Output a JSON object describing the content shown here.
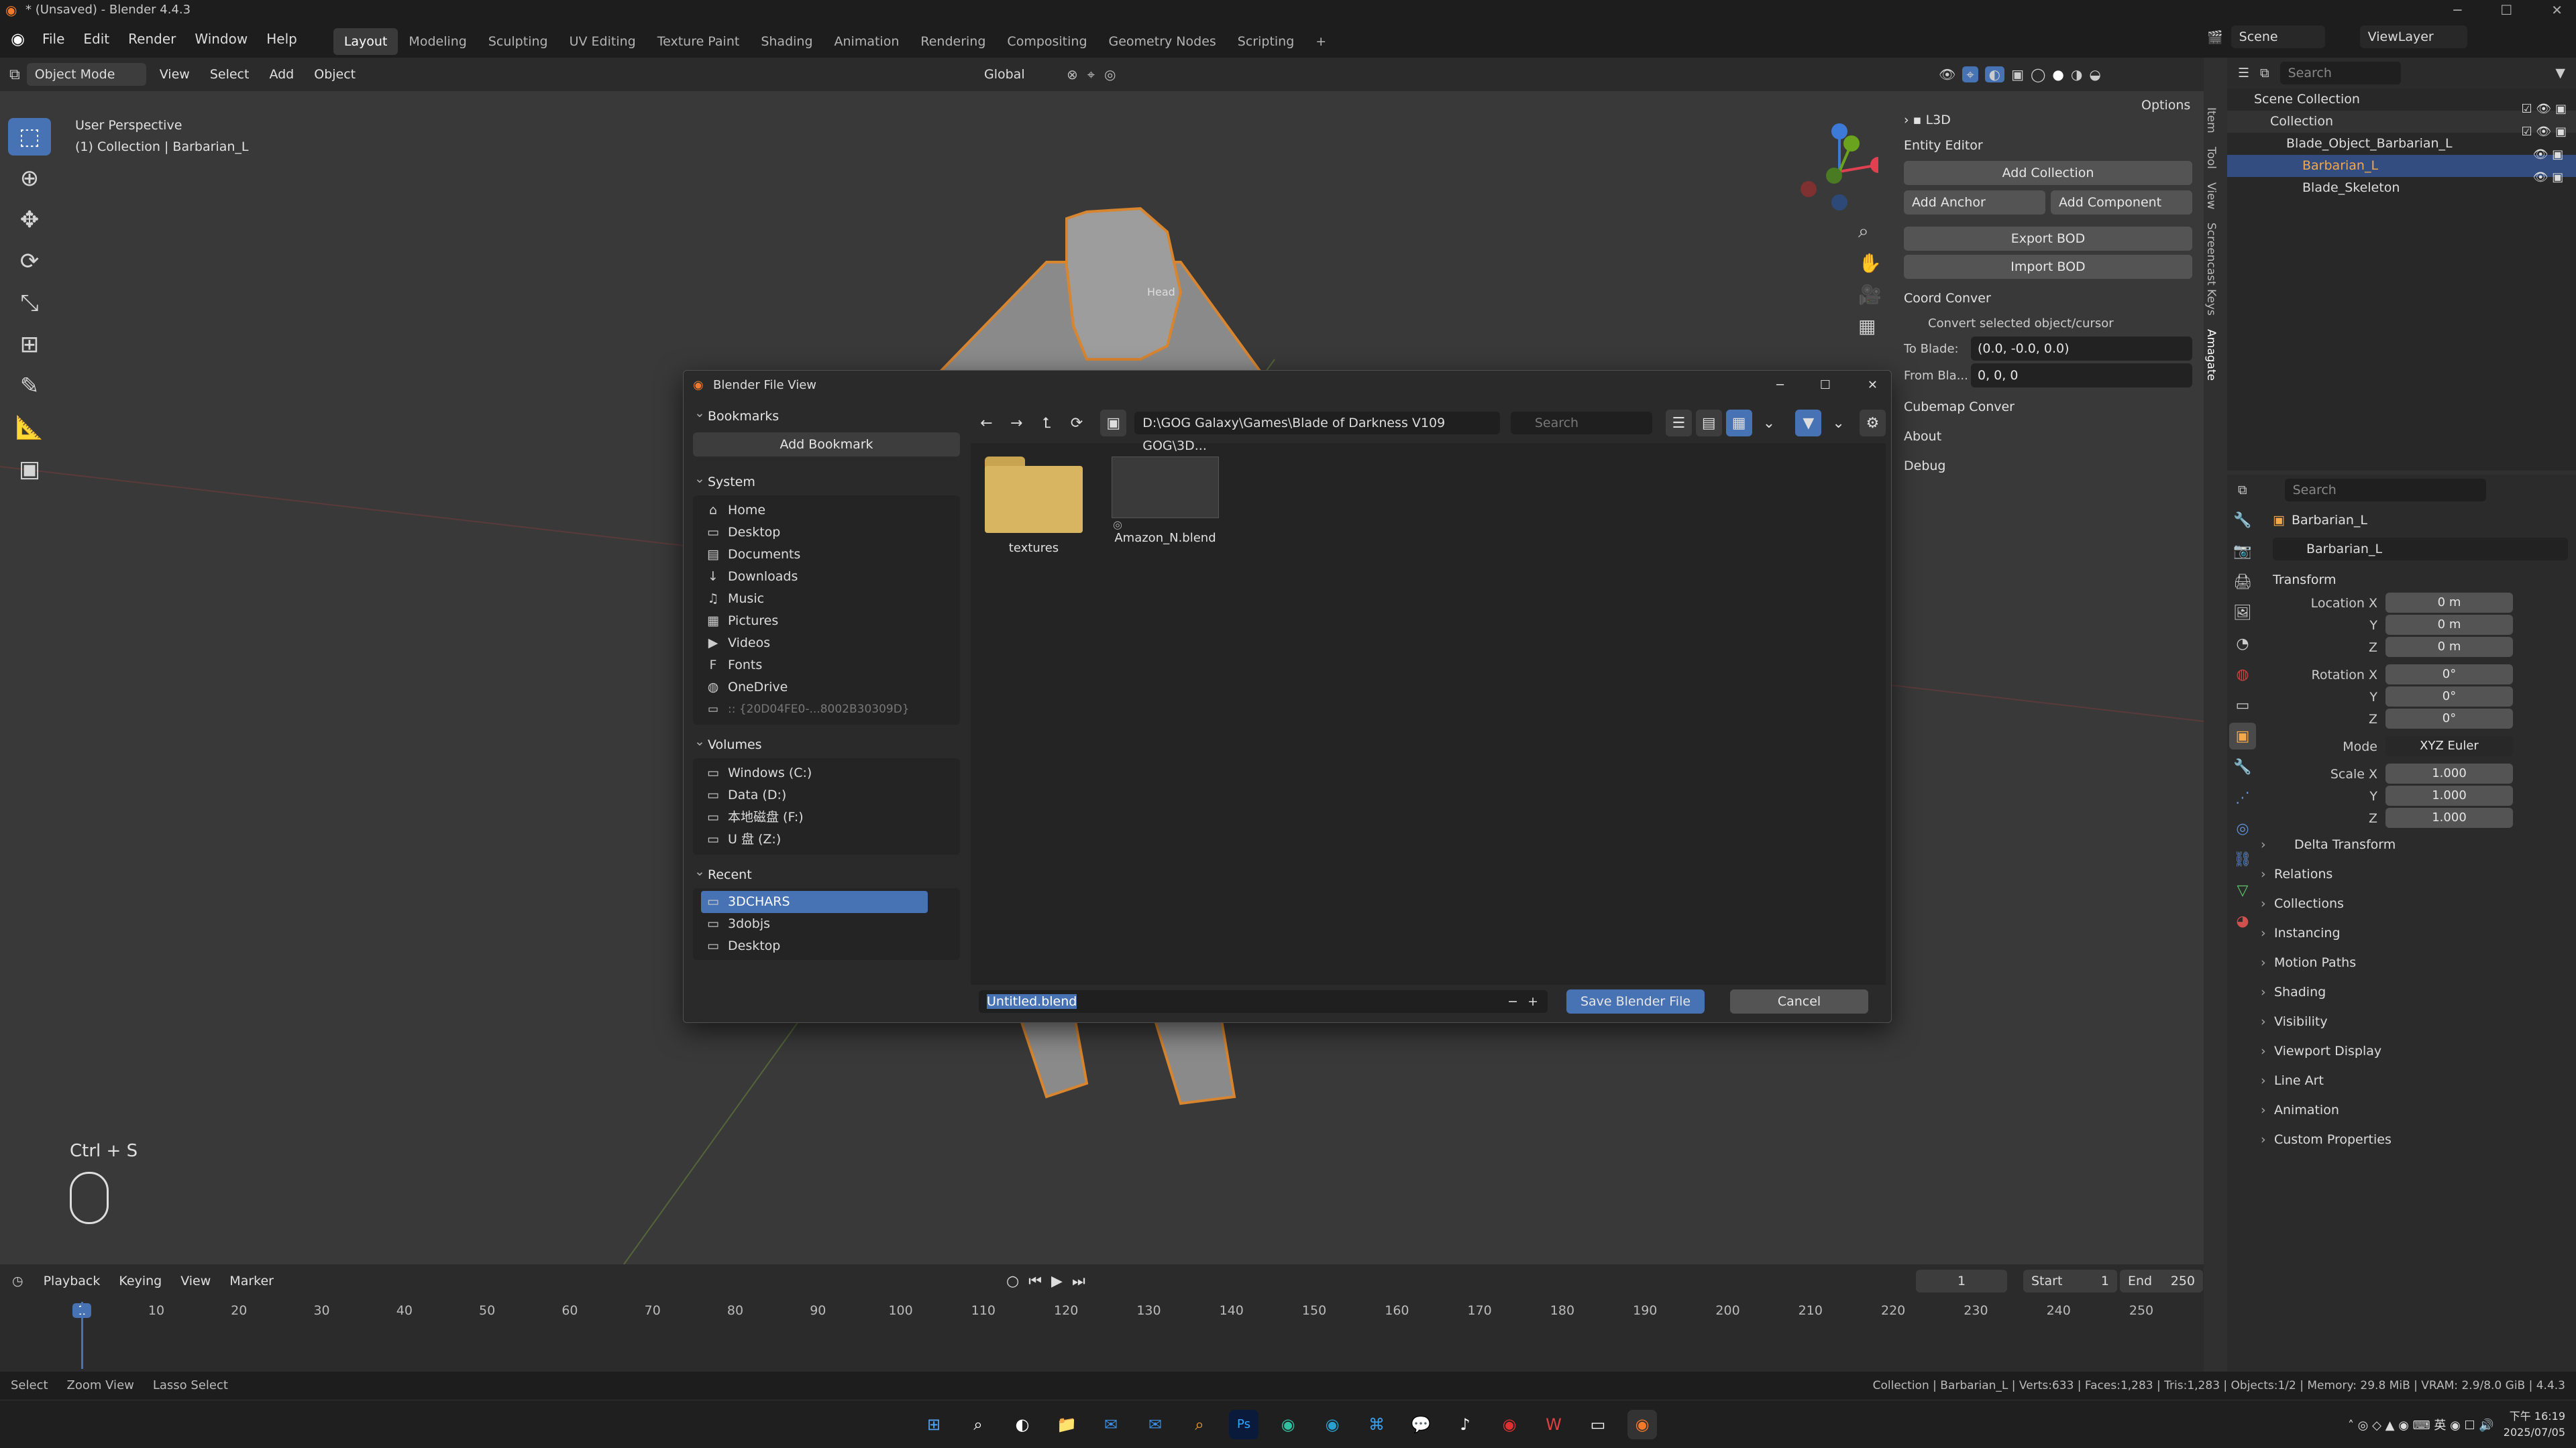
{
  "window": {
    "title": "* (Unsaved) - Blender 4.4.3"
  },
  "menu": {
    "items": [
      "File",
      "Edit",
      "Render",
      "Window",
      "Help"
    ]
  },
  "workspaces": [
    "Layout",
    "Modeling",
    "Sculpting",
    "UV Editing",
    "Texture Paint",
    "Shading",
    "Animation",
    "Rendering",
    "Compositing",
    "Geometry Nodes",
    "Scripting"
  ],
  "active_workspace": "Layout",
  "top_right": {
    "scene": "Scene",
    "view_layer": "ViewLayer"
  },
  "viewport_header": {
    "mode": "Object Mode",
    "menus": [
      "View",
      "Select",
      "Add",
      "Object"
    ],
    "orientation": "Global",
    "options": "Options"
  },
  "viewport": {
    "view_name": "User Perspective",
    "collection_info": "(1) Collection | Barbarian_L",
    "bone_label": "Head",
    "shortcut": "Ctrl + S"
  },
  "npanel": {
    "header": "L3D",
    "entity_editor": "Entity Editor",
    "add_collection": "Add Collection",
    "add_anchor": "Add Anchor",
    "add_component": "Add Component",
    "export_bod": "Export BOD",
    "import_bod": "Import BOD",
    "coord_conver": "Coord Conver",
    "convert_label": "Convert selected object/cursor",
    "to_blade_label": "To Blade:",
    "to_blade_value": "(0.0, -0.0, 0.0)",
    "from_blade_label": "From Bla...",
    "from_blade_value": "0, 0, 0",
    "cubemap": "Cubemap Conver",
    "about": "About",
    "debug": "Debug",
    "tabs": [
      "Item",
      "Tool",
      "View",
      "Screencast Keys",
      "Amagate"
    ]
  },
  "outliner": {
    "search_placeholder": "Search",
    "rows": [
      "Scene Collection",
      "Collection",
      "Blade_Object_Barbarian_L",
      "Barbarian_L",
      "Blade_Skeleton"
    ]
  },
  "properties": {
    "search_placeholder": "Search",
    "object_name": "Barbarian_L",
    "data_name": "Barbarian_L",
    "transform": "Transform",
    "location_label": "Location X",
    "rotation_label": "Rotation X",
    "scale_label": "Scale X",
    "y": "Y",
    "z": "Z",
    "location": [
      "0 m",
      "0 m",
      "0 m"
    ],
    "rotation": [
      "0°",
      "0°",
      "0°"
    ],
    "mode_label": "Mode",
    "mode_value": "XYZ Euler",
    "scale": [
      "1.000",
      "1.000",
      "1.000"
    ],
    "delta": "Delta Transform",
    "sections": [
      "Relations",
      "Collections",
      "Instancing",
      "Motion Paths",
      "Shading",
      "Visibility",
      "Viewport Display",
      "Line Art",
      "Animation",
      "Custom Properties"
    ]
  },
  "dialog": {
    "title": "Blender File View",
    "path": "D:\\GOG Galaxy\\Games\\Blade of Darkness V109 GOG\\3D...",
    "search_placeholder": "Search",
    "bookmarks": "Bookmarks",
    "add_bookmark": "Add Bookmark",
    "system": "System",
    "system_items": [
      "Home",
      "Desktop",
      "Documents",
      "Downloads",
      "Music",
      "Pictures",
      "Videos",
      "Fonts",
      "OneDrive",
      ":: {20D04FE0-...8002B30309D}"
    ],
    "volumes": "Volumes",
    "volume_items": [
      "Windows (C:)",
      "Data (D:)",
      "本地磁盘 (F:)",
      "U 盘 (Z:)"
    ],
    "recent": "Recent",
    "recent_items": [
      "3DCHARS",
      "3dobjs",
      "Desktop"
    ],
    "files": [
      "textures",
      "Amazon_N.blend"
    ],
    "filename": "Untitled.blend",
    "save_button": "Save Blender File",
    "cancel_button": "Cancel"
  },
  "timeline": {
    "menus": [
      "Playback",
      "Keying",
      "View",
      "Marker"
    ],
    "current_frame": "1",
    "start_label": "Start",
    "start": "1",
    "end_label": "End",
    "end": "250",
    "ticks": [
      "1",
      "10",
      "20",
      "30",
      "40",
      "50",
      "60",
      "70",
      "80",
      "90",
      "100",
      "110",
      "120",
      "130",
      "140",
      "150",
      "160",
      "170",
      "180",
      "190",
      "200",
      "210",
      "220",
      "230",
      "240",
      "250"
    ]
  },
  "statusbar": {
    "left": [
      "Select",
      "Zoom View",
      "Lasso Select"
    ],
    "right": "Collection | Barbarian_L | Verts:633 | Faces:1,283 | Tris:1,283 | Objects:1/2 | Memory: 29.8 MiB | VRAM: 2.9/8.0 GiB | 4.4.3"
  },
  "clock": {
    "time": "下午 16:19",
    "date": "2025/07/05"
  },
  "colors": {
    "accent": "#4772b3",
    "folder": "#d8b560",
    "selected_row": "#334d80"
  }
}
